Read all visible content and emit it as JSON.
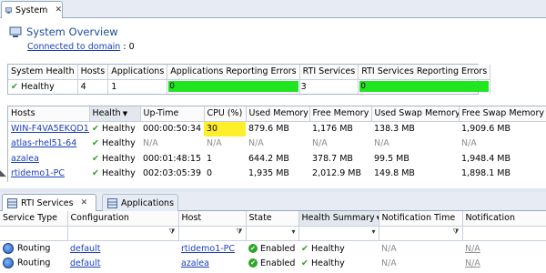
{
  "top_tab": {
    "label": "System"
  },
  "overview": {
    "title": "System Overview",
    "connected_link": "Connected to domain",
    "connected_count": ": 0"
  },
  "summary": {
    "headers": [
      "System Health",
      "Hosts",
      "Applications",
      "Applications Reporting Errors",
      "RTI Services",
      "RTI Services Reporting Errors"
    ],
    "system_health": "Healthy",
    "hosts": "4",
    "applications": "1",
    "app_errors": "0",
    "rti_services": "3",
    "rti_service_errors": "0"
  },
  "hosts_table": {
    "headers": [
      "Hosts",
      "Health",
      "Up-Time",
      "CPU (%)",
      "Used Memory",
      "Free Memory",
      "Used Swap Memory",
      "Free Swap Memory"
    ],
    "rows": [
      {
        "host": "WIN-F4VA5EKQD1L",
        "health": "Healthy",
        "uptime": "000:00:50:34",
        "cpu": "30",
        "used_mem": "879.6 MB",
        "free_mem": "1,176 MB",
        "used_swap": "138.3 MB",
        "free_swap": "1,909.6 MB"
      },
      {
        "host": "atlas-rhel51-64",
        "health": "Healthy",
        "uptime": "N/A",
        "cpu": "N/A",
        "used_mem": "N/A",
        "free_mem": "N/A",
        "used_swap": "N/A",
        "free_swap": "N/A"
      },
      {
        "host": "azalea",
        "health": "Healthy",
        "uptime": "000:01:48:15",
        "cpu": "1",
        "used_mem": "644.2 MB",
        "free_mem": "378.7 MB",
        "used_swap": "99.5 MB",
        "free_swap": "1,948.4 MB"
      },
      {
        "host": "rtidemo1-PC",
        "health": "Healthy",
        "uptime": "002:03:05:39",
        "cpu": "0",
        "used_mem": "1,935 MB",
        "free_mem": "2,012.9 MB",
        "used_swap": "149.8 MB",
        "free_swap": "1,898.1 MB"
      }
    ]
  },
  "bottom_tabs": {
    "rti_services": "RTI Services",
    "applications": "Applications"
  },
  "services_table": {
    "headers": [
      "Service Type",
      "Configuration",
      "Host",
      "State",
      "Health Summary",
      "Notification Time",
      "Notification"
    ],
    "rows": [
      {
        "type": "Routing",
        "config": "default",
        "host": "rtidemo1-PC",
        "state": "Enabled",
        "health": "Healthy",
        "notif_time": "N/A",
        "notif": "N/A"
      },
      {
        "type": "Routing",
        "config": "default",
        "host": "azalea",
        "state": "Enabled",
        "health": "Healthy",
        "notif_time": "N/A",
        "notif": "N/A"
      }
    ]
  },
  "colors": {
    "accent": "#1d4e9e",
    "ok_green": "#22e522",
    "cpu_highlight": "#ffef2a",
    "link": "#1a3fb8"
  }
}
